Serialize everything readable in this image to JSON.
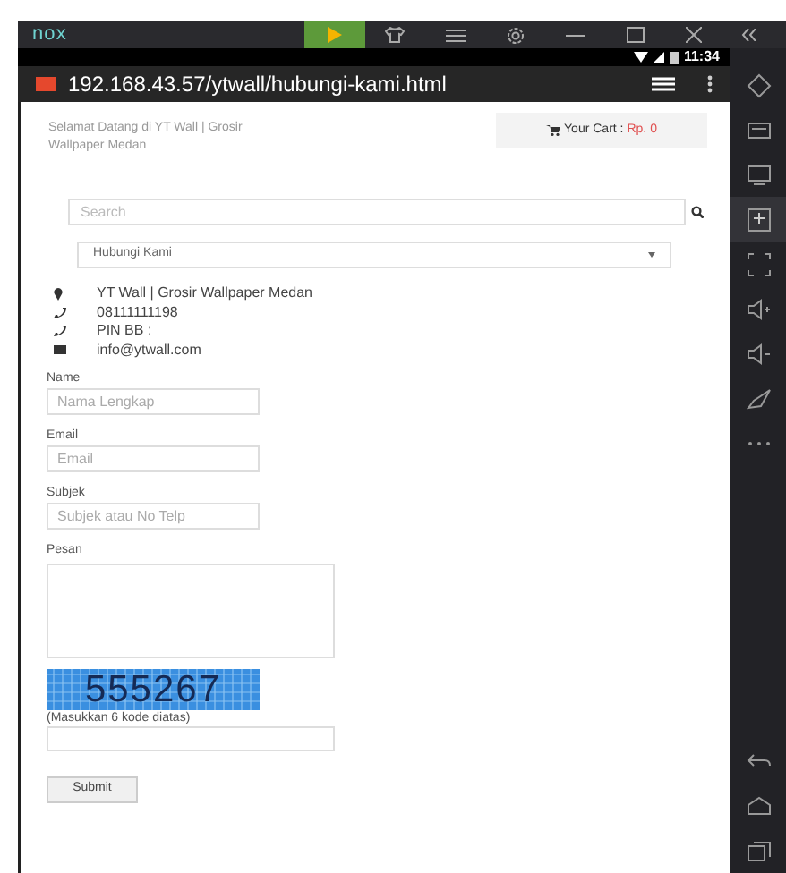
{
  "emulator": {
    "logo": "nox"
  },
  "status_bar": {
    "time": "11:34"
  },
  "browser": {
    "url": "192.168.43.57/ytwall/hubungi-kami.html"
  },
  "page": {
    "welcome": "Selamat Datang di YT Wall | Grosir Wallpaper Medan",
    "cart_label": "Your Cart :",
    "cart_total": "Rp. 0",
    "search": {
      "placeholder": "Search"
    },
    "menu_select": {
      "value": "Hubungi Kami"
    },
    "contacts": [
      {
        "kind": "location",
        "text": "YT Wall | Grosir Wallpaper Medan"
      },
      {
        "kind": "phone",
        "text": "08111111198"
      },
      {
        "kind": "phone",
        "text": "PIN BB :"
      },
      {
        "kind": "email",
        "text": "info@ytwall.com"
      }
    ],
    "form": {
      "fields": [
        {
          "kind": "input",
          "label": "Name",
          "placeholder": "Nama Lengkap"
        },
        {
          "kind": "input",
          "label": "Email",
          "placeholder": "Email"
        },
        {
          "kind": "input",
          "label": "Subjek",
          "placeholder": "Subjek atau No Telp"
        },
        {
          "kind": "textarea",
          "label": "Pesan"
        }
      ],
      "captcha": {
        "code": "555267",
        "hint": "(Masukkan 6 kode diatas)"
      },
      "submit": "Submit"
    }
  }
}
